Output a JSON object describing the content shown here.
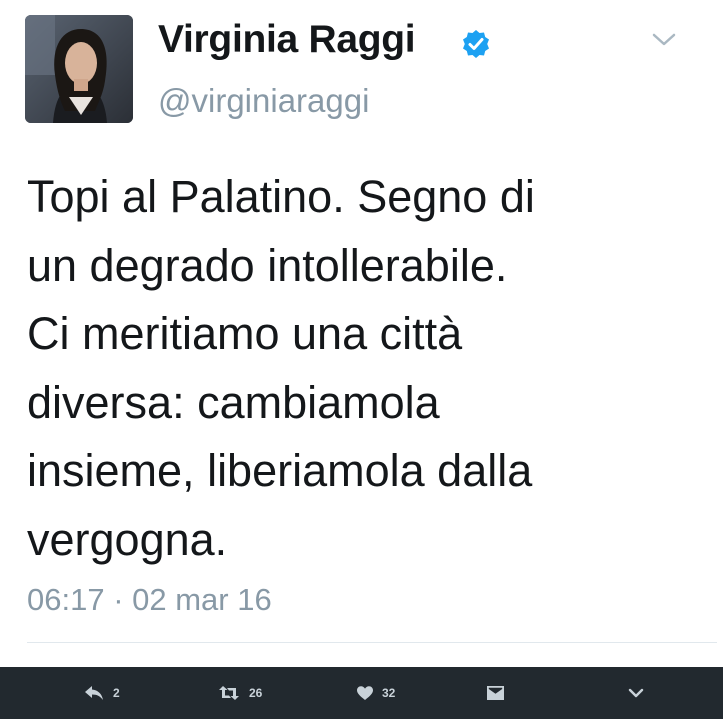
{
  "profile": {
    "display_name": "Virginia Raggi",
    "handle": "@virginiaraggi",
    "verified": true
  },
  "tweet": {
    "lines": [
      "Topi al Palatino. Segno di",
      "un degrado intollerabile.",
      "Ci meritiamo una città",
      "diversa: cambiamola",
      "insieme, liberiamola dalla",
      "vergogna."
    ],
    "timestamp": "06:17 · 02 mar 16"
  },
  "actions": {
    "reply_count": "2",
    "retweet_count": "26",
    "like_count": "32"
  },
  "colors": {
    "verified_badge": "#1da1f2",
    "action_bar_bg": "#22292f",
    "secondary_text": "#8899a6",
    "primary_text": "#14171a"
  },
  "icons": [
    "verified-icon",
    "chevron-down-icon",
    "reply-icon",
    "retweet-icon",
    "heart-icon",
    "message-icon"
  ]
}
